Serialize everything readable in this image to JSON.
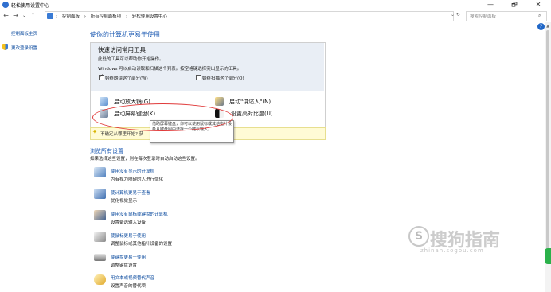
{
  "window": {
    "title": "轻松使用设置中心",
    "minimize": "—",
    "maximize": "🗗",
    "close": "✕"
  },
  "nav": {
    "back": "←",
    "forward": "→",
    "dropdown": "⌄",
    "up": "↑",
    "breadcrumbs": [
      "›",
      "控制面板",
      "›",
      "所有控制面板项",
      "›",
      "轻松使用设置中心"
    ],
    "refresh_icon": "⌄ ↻",
    "search_placeholder": "搜索控制面板",
    "search_icon": "⌕"
  },
  "sidebar": {
    "home": "控制面板主页",
    "change_login": "更改登录设置"
  },
  "help": "?",
  "main": {
    "heading": "使你的计算机更易于使用",
    "quick": {
      "title": "快速访问常用工具",
      "line1": "此处的工具可以帮助你开始操作。",
      "line2": "Windows 可以启动读取和扫描这个列表。按空格键选择突出显示的工具。",
      "check1": "始终朗读这个部分(W)",
      "check2": "始终扫描这个部分(O)",
      "tools": {
        "magnifier": "启动放大镜(G)",
        "narrator": "启动\"讲述人\"(N)",
        "osk": "启动屏幕键盘(K)",
        "contrast": "设置高对比度(U)"
      },
      "tip": "不确定从哪里开始? 获",
      "tooltip": "借助屏幕键盘，你可以使用鼠标或其他指针设备从键盘图中选择一个键以输入。"
    },
    "browse": {
      "heading": "浏览所有设置",
      "desc": "如果选择这些设置，则在每次登录时自动启动这些设置。",
      "items": [
        {
          "link": "使用没有显示的计算机",
          "sub": "为有视力障碍的人进行优化"
        },
        {
          "link": "使计算机更易于查看",
          "sub": "优化视觉显示"
        },
        {
          "link": "使用没有鼠标或键盘的计算机",
          "sub": "设置备选输入设备"
        },
        {
          "link": "使鼠标更易于使用",
          "sub": "调整鼠标或其他指针设备的设置"
        },
        {
          "link": "使键盘更易于使用",
          "sub": "调整键盘设置"
        },
        {
          "link": "用文本或视频替代声音",
          "sub": "设置声音的替代项"
        }
      ]
    }
  },
  "watermark": {
    "logo": "S",
    "text": "搜狗指南",
    "url": "zhinan.sogou.com"
  },
  "colors": {
    "accent": "#1e5bb3",
    "link": "#0a4a9e",
    "annotation": "#e03a3a",
    "tip_bg": "#fffbd5"
  }
}
